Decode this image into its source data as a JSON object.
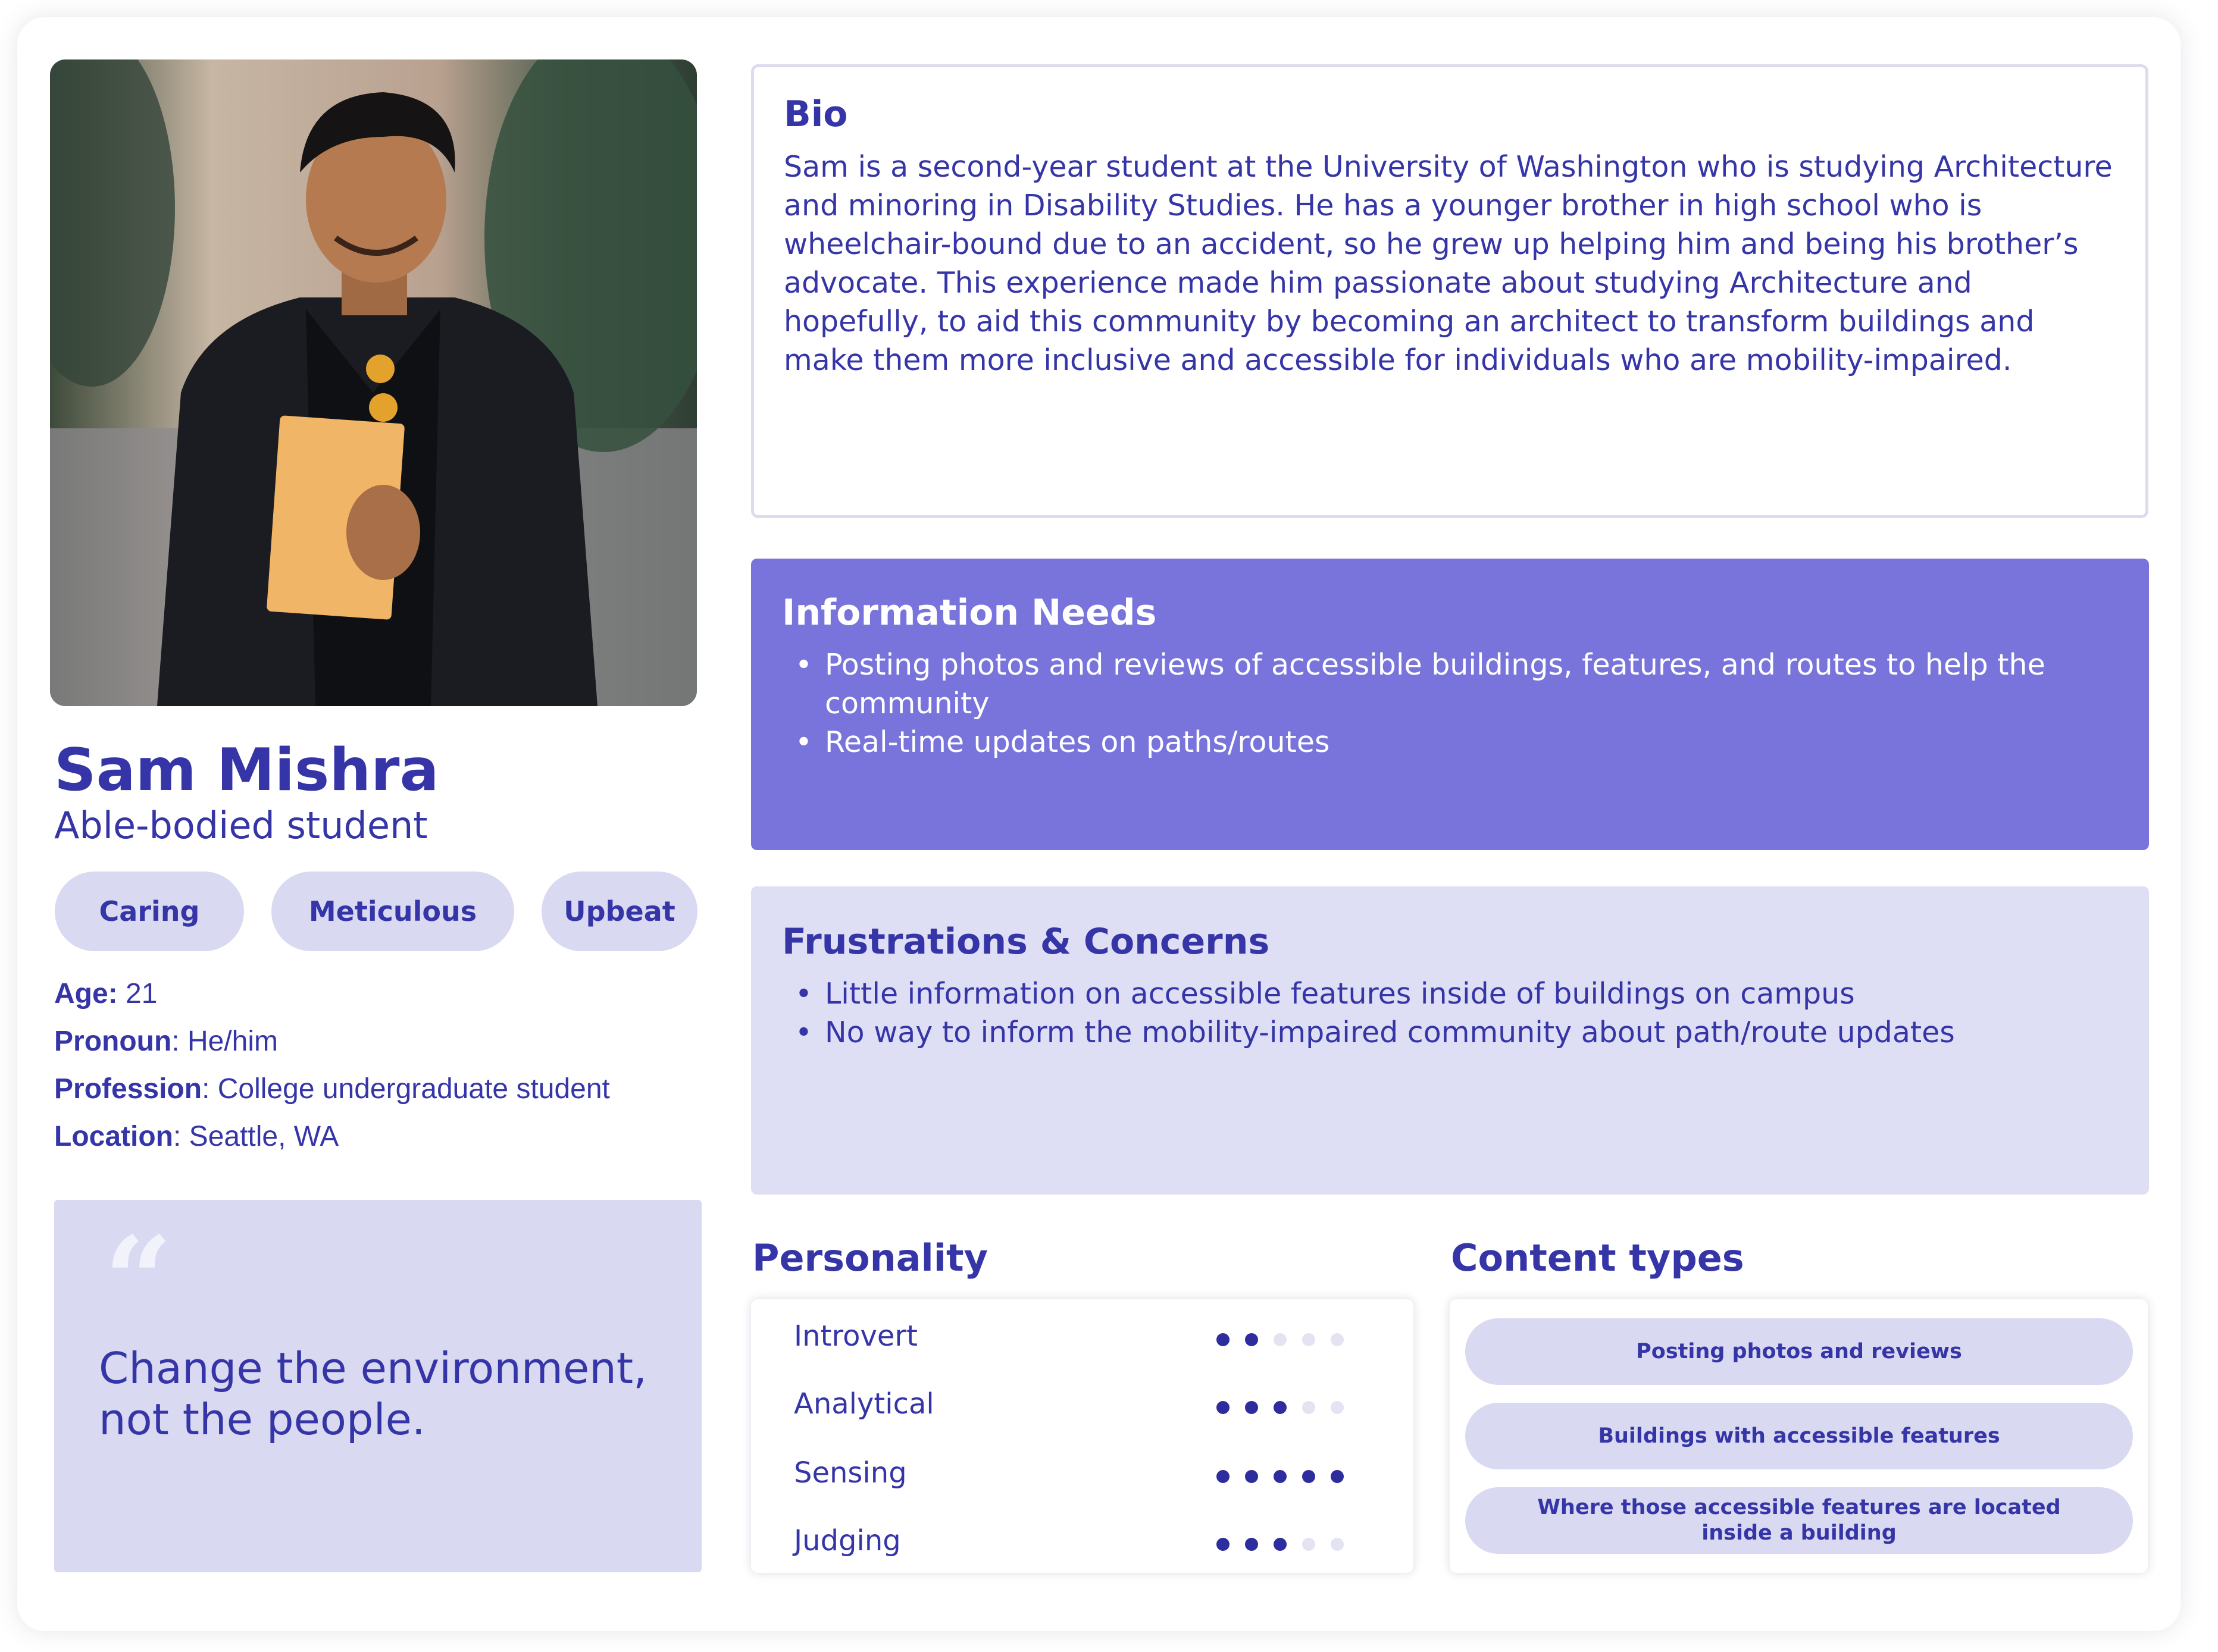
{
  "persona": {
    "name": "Sam Mishra",
    "role": "Able-bodied student",
    "tags": [
      "Caring",
      "Meticulous",
      "Upbeat"
    ],
    "facts": [
      {
        "label": "Age:",
        "value": " 21"
      },
      {
        "label": "Pronoun",
        "value": ": He/him"
      },
      {
        "label": "Profession",
        "value": ": College undergraduate student"
      },
      {
        "label": "Location",
        "value": ": Seattle, WA"
      }
    ],
    "quote": "Change the environment, not the people."
  },
  "bio": {
    "title": "Bio",
    "text": "Sam is a second-year student at the University of Washington who is studying Architecture and minoring in Disability Studies. He has a younger brother in high school who is wheelchair-bound due to an accident, so he grew up helping him and being his brother’s advocate. This experience made him passionate about studying Architecture and hopefully, to aid this community by becoming an architect to transform buildings and make them more inclusive and accessible for individuals who are mobility-impaired."
  },
  "information_needs": {
    "title": "Information Needs",
    "items": [
      "Posting photos and reviews of accessible buildings, features, and routes to help the community",
      "Real-time updates on paths/routes"
    ]
  },
  "frustrations": {
    "title": "Frustrations & Concerns",
    "items": [
      "Little information on accessible features inside of buildings on campus",
      "No way to inform the mobility-impaired community about path/route updates"
    ]
  },
  "personality": {
    "title": "Personality",
    "scale_max": 5,
    "traits": [
      {
        "name": "Introvert",
        "level": 2
      },
      {
        "name": "Analytical",
        "level": 3
      },
      {
        "name": "Sensing",
        "level": 5
      },
      {
        "name": "Judging",
        "level": 3
      }
    ]
  },
  "content_types": {
    "title": "Content types",
    "items": [
      "Posting photos and reviews",
      "Buildings with accessible features",
      "Where those accessible features are located inside a building"
    ]
  },
  "colors": {
    "primary": "#3535a8",
    "needs_bg": "#7874db",
    "light_bg": "#d9d9f1",
    "dot_on": "#2d2d9e",
    "dot_off": "#e3e3f2"
  }
}
